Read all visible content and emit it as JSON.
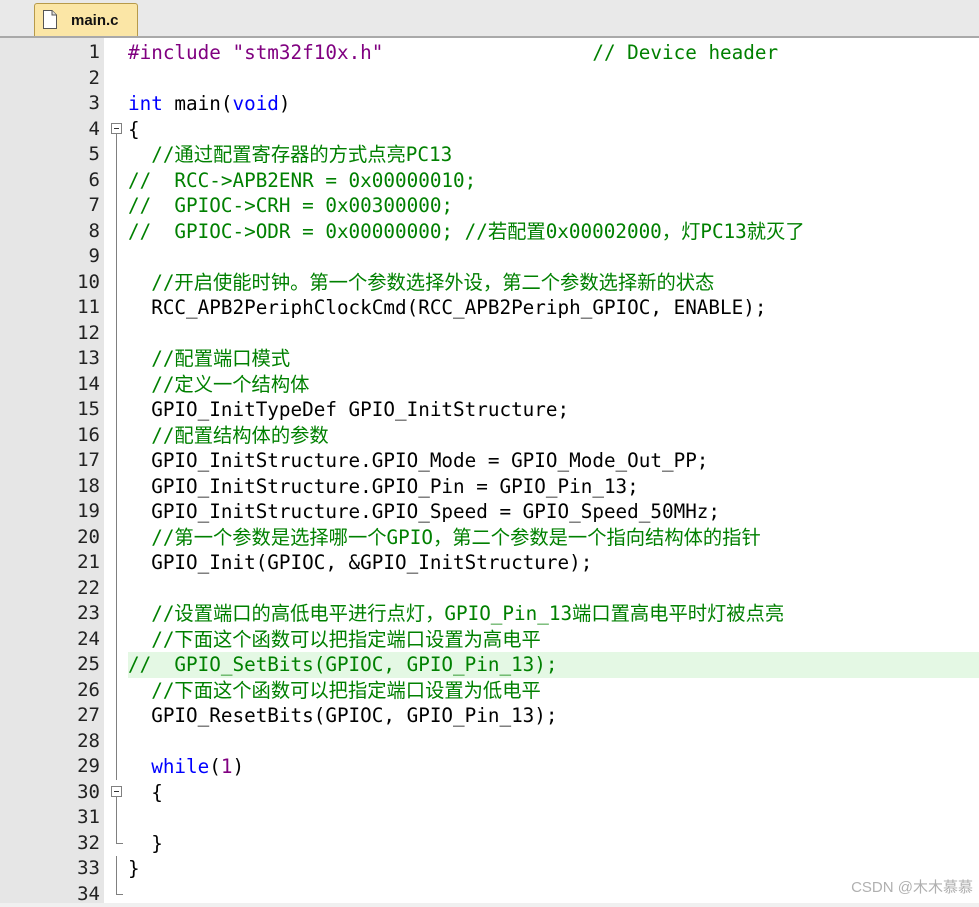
{
  "tab": {
    "label": "main.c",
    "icon": "file-icon"
  },
  "watermark": "CSDN @木木慕慕",
  "colors": {
    "comment": "#008000",
    "keyword": "#0000ff",
    "preprocessor": "#800080",
    "highlight_line": "#e4f8e4",
    "tab_background": "#fbe6a6"
  },
  "lines": [
    {
      "n": "1",
      "fold": "none",
      "tokens": [
        {
          "t": "#include ",
          "c": "pp"
        },
        {
          "t": "\"stm32f10x.h\"",
          "c": "str"
        },
        {
          "t": "                  ",
          "c": "tx"
        },
        {
          "t": "// Device header",
          "c": "cm"
        }
      ]
    },
    {
      "n": "2",
      "fold": "none",
      "tokens": []
    },
    {
      "n": "3",
      "fold": "none",
      "tokens": [
        {
          "t": "int",
          "c": "kw"
        },
        {
          "t": " main(",
          "c": "tx"
        },
        {
          "t": "void",
          "c": "kw"
        },
        {
          "t": ")",
          "c": "tx"
        }
      ]
    },
    {
      "n": "4",
      "fold": "open",
      "tokens": [
        {
          "t": "{",
          "c": "tx"
        }
      ]
    },
    {
      "n": "5",
      "fold": "line",
      "tokens": [
        {
          "t": "  //通过配置寄存器的方式点亮PC13",
          "c": "cm"
        }
      ]
    },
    {
      "n": "6",
      "fold": "line",
      "tokens": [
        {
          "t": "//  RCC->APB2ENR = 0x00000010;",
          "c": "cm"
        }
      ]
    },
    {
      "n": "7",
      "fold": "line",
      "tokens": [
        {
          "t": "//  GPIOC->CRH = 0x00300000;",
          "c": "cm"
        }
      ]
    },
    {
      "n": "8",
      "fold": "line",
      "tokens": [
        {
          "t": "//  GPIOC->ODR = 0x00000000; //若配置0x00002000，灯PC13就灭了",
          "c": "cm"
        }
      ]
    },
    {
      "n": "9",
      "fold": "line",
      "tokens": []
    },
    {
      "n": "10",
      "fold": "line",
      "tokens": [
        {
          "t": "  //开启使能时钟。第一个参数选择外设，第二个参数选择新的状态",
          "c": "cm"
        }
      ]
    },
    {
      "n": "11",
      "fold": "line",
      "tokens": [
        {
          "t": "  RCC_APB2PeriphClockCmd(RCC_APB2Periph_GPIOC, ENABLE);",
          "c": "tx"
        }
      ]
    },
    {
      "n": "12",
      "fold": "line",
      "tokens": []
    },
    {
      "n": "13",
      "fold": "line",
      "tokens": [
        {
          "t": "  //配置端口模式",
          "c": "cm"
        }
      ]
    },
    {
      "n": "14",
      "fold": "line",
      "tokens": [
        {
          "t": "  //定义一个结构体",
          "c": "cm"
        }
      ]
    },
    {
      "n": "15",
      "fold": "line",
      "tokens": [
        {
          "t": "  GPIO_InitTypeDef GPIO_InitStructure;",
          "c": "tx"
        }
      ]
    },
    {
      "n": "16",
      "fold": "line",
      "tokens": [
        {
          "t": "  //配置结构体的参数",
          "c": "cm"
        }
      ]
    },
    {
      "n": "17",
      "fold": "line",
      "tokens": [
        {
          "t": "  GPIO_InitStructure.GPIO_Mode = GPIO_Mode_Out_PP;",
          "c": "tx"
        }
      ]
    },
    {
      "n": "18",
      "fold": "line",
      "tokens": [
        {
          "t": "  GPIO_InitStructure.GPIO_Pin = GPIO_Pin_13;",
          "c": "tx"
        }
      ]
    },
    {
      "n": "19",
      "fold": "line",
      "tokens": [
        {
          "t": "  GPIO_InitStructure.GPIO_Speed = GPIO_Speed_50MHz;",
          "c": "tx"
        }
      ]
    },
    {
      "n": "20",
      "fold": "line",
      "tokens": [
        {
          "t": "  //第一个参数是选择哪一个GPIO，第二个参数是一个指向结构体的指针",
          "c": "cm"
        }
      ]
    },
    {
      "n": "21",
      "fold": "line",
      "tokens": [
        {
          "t": "  GPIO_Init(GPIOC, &GPIO_InitStructure);",
          "c": "tx"
        }
      ]
    },
    {
      "n": "22",
      "fold": "line",
      "tokens": []
    },
    {
      "n": "23",
      "fold": "line",
      "tokens": [
        {
          "t": "  //设置端口的高低电平进行点灯，GPIO_Pin_13端口置高电平时灯被点亮",
          "c": "cm"
        }
      ]
    },
    {
      "n": "24",
      "fold": "line",
      "tokens": [
        {
          "t": "  //下面这个函数可以把指定端口设置为高电平",
          "c": "cm"
        }
      ]
    },
    {
      "n": "25",
      "fold": "line",
      "highlight": true,
      "tokens": [
        {
          "t": "//  GPIO_SetBits(GPIOC, GPIO_Pin_13);",
          "c": "cm"
        }
      ]
    },
    {
      "n": "26",
      "fold": "line",
      "tokens": [
        {
          "t": "  //下面这个函数可以把指定端口设置为低电平",
          "c": "cm"
        }
      ]
    },
    {
      "n": "27",
      "fold": "line",
      "tokens": [
        {
          "t": "  GPIO_ResetBits(GPIOC, GPIO_Pin_13);",
          "c": "tx"
        }
      ]
    },
    {
      "n": "28",
      "fold": "line",
      "tokens": []
    },
    {
      "n": "29",
      "fold": "line",
      "tokens": [
        {
          "t": "  ",
          "c": "tx"
        },
        {
          "t": "while",
          "c": "kw"
        },
        {
          "t": "(",
          "c": "tx"
        },
        {
          "t": "1",
          "c": "num"
        },
        {
          "t": ")",
          "c": "tx"
        }
      ]
    },
    {
      "n": "30",
      "fold": "open",
      "tokens": [
        {
          "t": "  {",
          "c": "tx"
        }
      ]
    },
    {
      "n": "31",
      "fold": "line",
      "tokens": []
    },
    {
      "n": "32",
      "fold": "end",
      "tokens": [
        {
          "t": "  }",
          "c": "tx"
        }
      ]
    },
    {
      "n": "33",
      "fold": "line",
      "tokens": [
        {
          "t": "}",
          "c": "tx"
        }
      ]
    },
    {
      "n": "34",
      "fold": "end",
      "tokens": []
    }
  ]
}
